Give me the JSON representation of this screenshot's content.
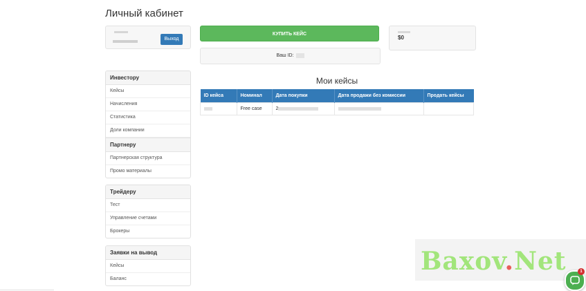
{
  "page_title": "Личный кабинет",
  "user_box": {
    "logout_label": "Выход"
  },
  "buy_button_label": "КУПИТЬ КЕЙС",
  "your_id_label": "Ваш ID:",
  "balance": {
    "value": "$0"
  },
  "menu_groups": [
    {
      "title": "Инвестору",
      "items": [
        "Кейсы",
        "Начисления",
        "Статистика",
        "Доли компании"
      ]
    },
    {
      "title": "Партнеру",
      "items": [
        "Партнерская структура",
        "Промо материалы"
      ]
    },
    {
      "title": "Трейдеру",
      "items": [
        "Тест",
        "Управление счетами",
        "Брокеры"
      ]
    },
    {
      "title": "Заявки на вывод",
      "items": [
        "Кейсы",
        "Баланс"
      ]
    }
  ],
  "cases_section": {
    "title": "Мои кейсы",
    "columns": [
      "ID кейса",
      "Номинал",
      "Дата покупки",
      "Дата продажи без комиссии",
      "Продать кейсы"
    ],
    "rows": [
      {
        "nominal": "Free case",
        "purchase_date_prefix": "2"
      }
    ]
  },
  "watermark": {
    "text": "Baxov",
    "dot": ".",
    "suffix": "Net"
  },
  "chat_badge_count": "1",
  "colors": {
    "primary": "#337ab7",
    "success": "#5cb85c",
    "panel_bg": "#f7f7f7"
  }
}
